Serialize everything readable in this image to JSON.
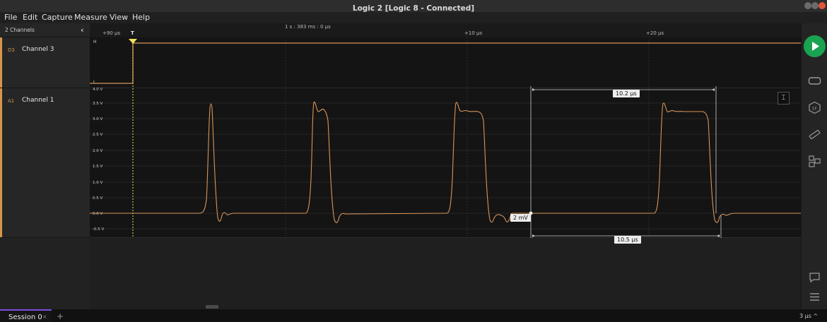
{
  "window": {
    "title": "Logic 2 [Logic 8 - Connected]"
  },
  "menu": {
    "items": [
      "File",
      "Edit",
      "Capture",
      "Measure",
      "View",
      "Help"
    ]
  },
  "sidebar": {
    "header_label": "2 Channels",
    "collapse_icon": "chevron-left-icon",
    "channels": [
      {
        "tag": "D3",
        "name": "Channel 3"
      },
      {
        "tag": "A1",
        "name": "Channel 1"
      }
    ]
  },
  "timeline": {
    "absolute_time": "1 s : 383 ms : 0 μs",
    "ticks": [
      "+90 μs",
      "+10 μs",
      "+20 μs"
    ],
    "trigger_label": "T"
  },
  "digital": {
    "high_label": "H",
    "low_label": "L"
  },
  "analog": {
    "y_ticks": [
      "4.0 V",
      "3.5 V",
      "3.0 V",
      "2.5 V",
      "2.0 V",
      "1.5 V",
      "1.0 V",
      "0.5 V",
      "0.0 V",
      "-0.5 V"
    ],
    "cursor_value": "2 mV",
    "measure_top": "10.2 μs",
    "measure_bottom": "10.5 μs",
    "yaxis_toggle_icon": "vertical-scale-icon"
  },
  "colors": {
    "trace": "#d8955a",
    "trigger": "#f2e25a",
    "play": "#1aa351",
    "session_accent": "#7b4de0"
  },
  "right_panel": {
    "play_icon": "play-icon",
    "icons": [
      "analyzers-icon",
      "extensions-icon",
      "measure-icon",
      "timing-markers-icon",
      "feedback-icon",
      "menu-icon"
    ]
  },
  "status": {
    "session_tab": "Session 0",
    "session_close": "×",
    "add_session": "+",
    "zoom": "3 μs ^"
  }
}
